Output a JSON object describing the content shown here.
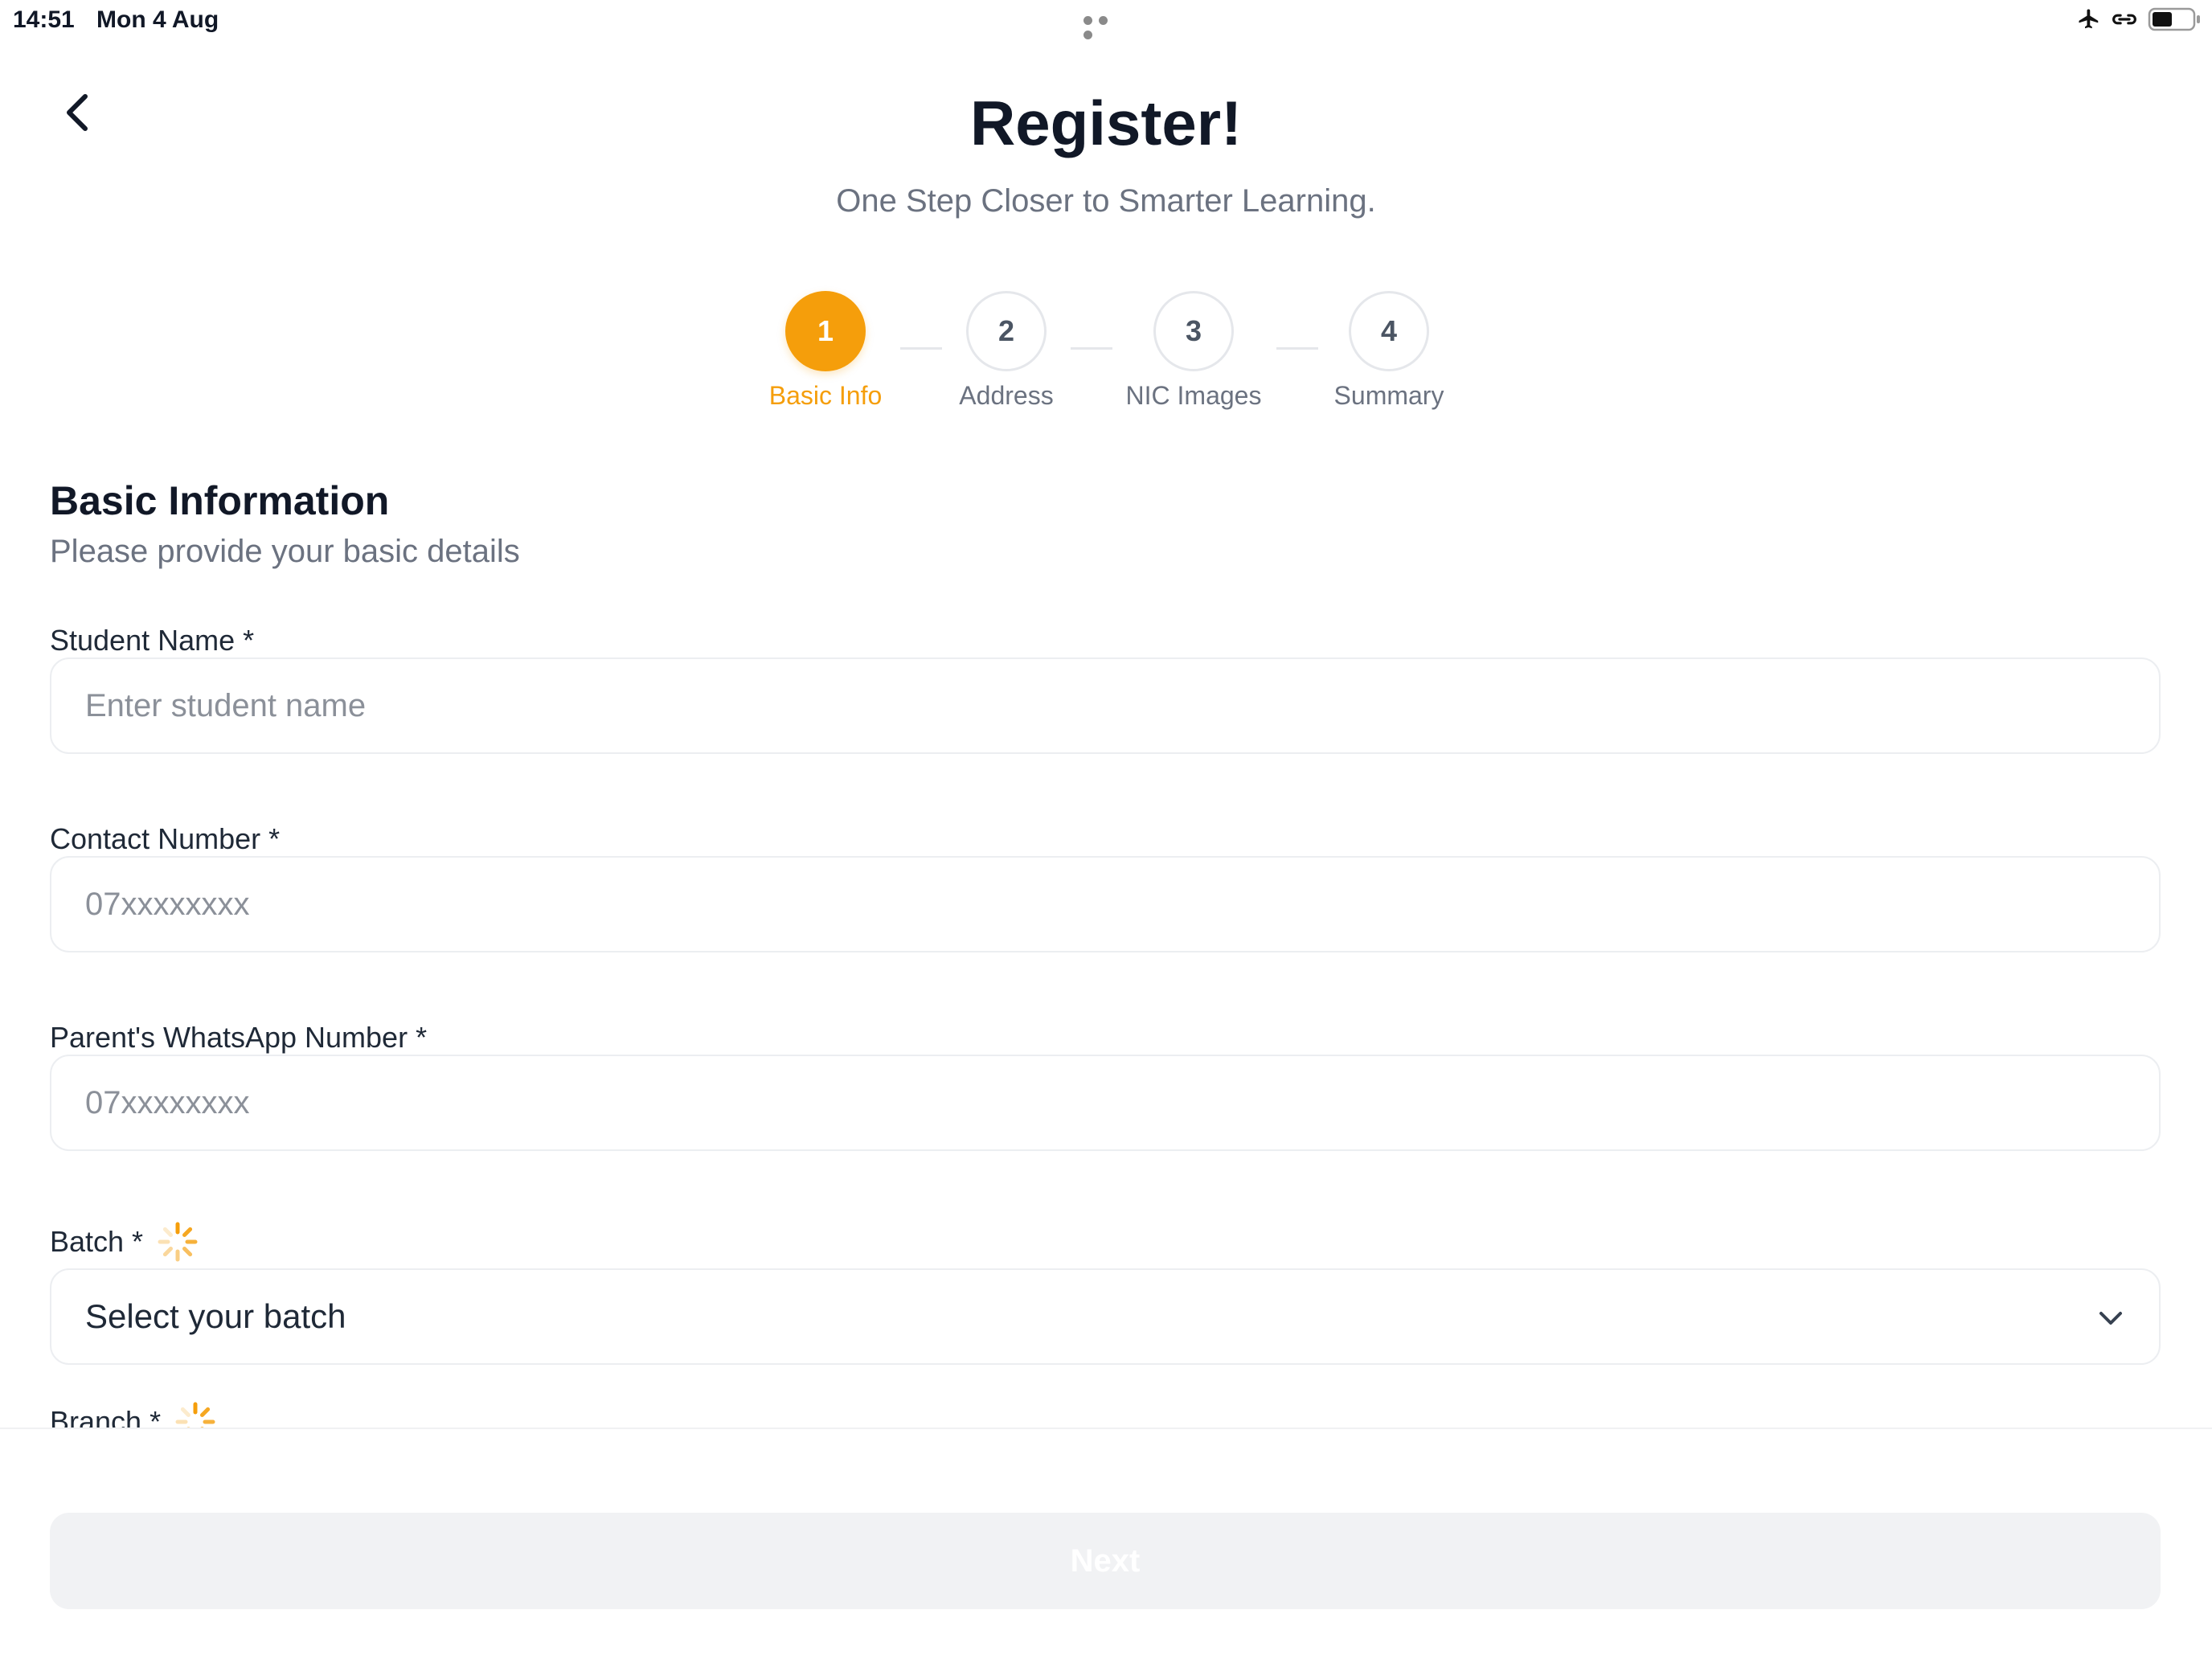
{
  "status_bar": {
    "time": "14:51",
    "date": "Mon 4 Aug",
    "icons": [
      "airplane-icon",
      "link-icon",
      "battery-icon"
    ]
  },
  "header": {
    "title": "Register!",
    "subtitle": "One Step Closer to Smarter Learning.",
    "back_icon": "chevron-left-icon"
  },
  "stepper": {
    "current_step": 1,
    "steps": [
      {
        "number": "1",
        "label": "Basic Info"
      },
      {
        "number": "2",
        "label": "Address"
      },
      {
        "number": "3",
        "label": "NIC Images"
      },
      {
        "number": "4",
        "label": "Summary"
      }
    ]
  },
  "section": {
    "title": "Basic Information",
    "subtitle": "Please provide your basic details"
  },
  "form": {
    "student_name": {
      "label": "Student Name *",
      "value": "",
      "placeholder": "Enter student name"
    },
    "contact_number": {
      "label": "Contact Number *",
      "value": "",
      "placeholder": "07xxxxxxxx"
    },
    "parent_whatsapp": {
      "label": "Parent's WhatsApp Number *",
      "value": "",
      "placeholder": "07xxxxxxxx"
    },
    "batch": {
      "label": "Batch *",
      "selected": "Select your batch",
      "loading_icon": "spinner-icon"
    },
    "branch": {
      "label": "Branch *",
      "loading_icon": "spinner-icon"
    }
  },
  "actions": {
    "next_label": "Next"
  },
  "colors": {
    "accent": "#f59e0b",
    "title": "#111827",
    "muted": "#6b7280",
    "border": "#eceef1",
    "disabled_button": "#f1f2f4"
  }
}
